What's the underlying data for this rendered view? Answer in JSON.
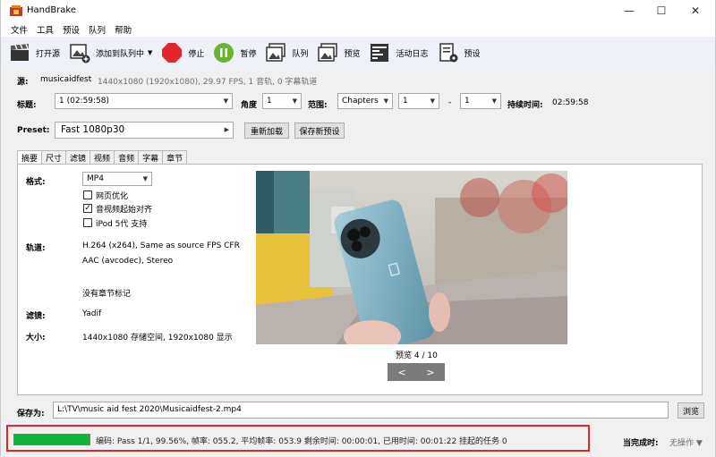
{
  "window": {
    "title": "HandBrake"
  },
  "menu": [
    "文件",
    "工具",
    "预设",
    "队列",
    "帮助"
  ],
  "toolbar": {
    "open_source": "打开源",
    "add_to_queue": "添加到队列中",
    "stop": "停止",
    "pause": "暂停",
    "queue": "队列",
    "preview": "预览",
    "activity_log": "活动日志",
    "presets": "预设"
  },
  "source": {
    "label": "源:",
    "name": "musicaidfest",
    "info": "1440x1080 (1920x1080), 29.97 FPS, 1 音轨, 0 字幕轨道"
  },
  "title_row": {
    "title_label": "标题:",
    "title_value": "1 (02:59:58)",
    "angle_label": "角度",
    "angle_value": "1",
    "range_label": "范围:",
    "range_type": "Chapters",
    "range_start": "1",
    "range_sep": "-",
    "range_end": "1",
    "duration_label": "持续时间:",
    "duration_value": "02:59:58"
  },
  "preset": {
    "label": "Preset:",
    "value": "Fast 1080p30",
    "reload": "重新加载",
    "save_new": "保存新预设"
  },
  "tabs": [
    "摘要",
    "尺寸",
    "滤镜",
    "视频",
    "音频",
    "字幕",
    "章节"
  ],
  "summary": {
    "format_label": "格式:",
    "format_value": "MP4",
    "web_optimized": "网页优化",
    "av_align": "音视频起始对齐",
    "ipod": "iPod 5代 支持",
    "tracks_label": "轨道:",
    "track_video": "H.264 (x264), Same as source FPS CFR",
    "track_audio": "AAC (avcodec), Stereo",
    "chapters_note": "没有章节标记",
    "filters_label": "滤镜:",
    "filters_value": "Yadif",
    "size_label": "大小:",
    "size_value": "1440x1080 存储空间, 1920x1080 显示",
    "preview_caption": "预览 4 / 10",
    "prev_btn": "<",
    "next_btn": ">"
  },
  "save": {
    "label": "保存为:",
    "path": "L:\\TV\\music aid fest 2020\\Musicaidfest-2.mp4",
    "browse": "浏览"
  },
  "status": {
    "progress": 0.9956,
    "text": "编码: Pass 1/1, 99.56%, 帧率: 055.2, 平均帧率: 053.9 剩余时间: 00:00:01, 已用时间: 00:01:22   挂起的任务 0",
    "when_done_label": "当完成时:",
    "when_done_value": "无操作"
  }
}
